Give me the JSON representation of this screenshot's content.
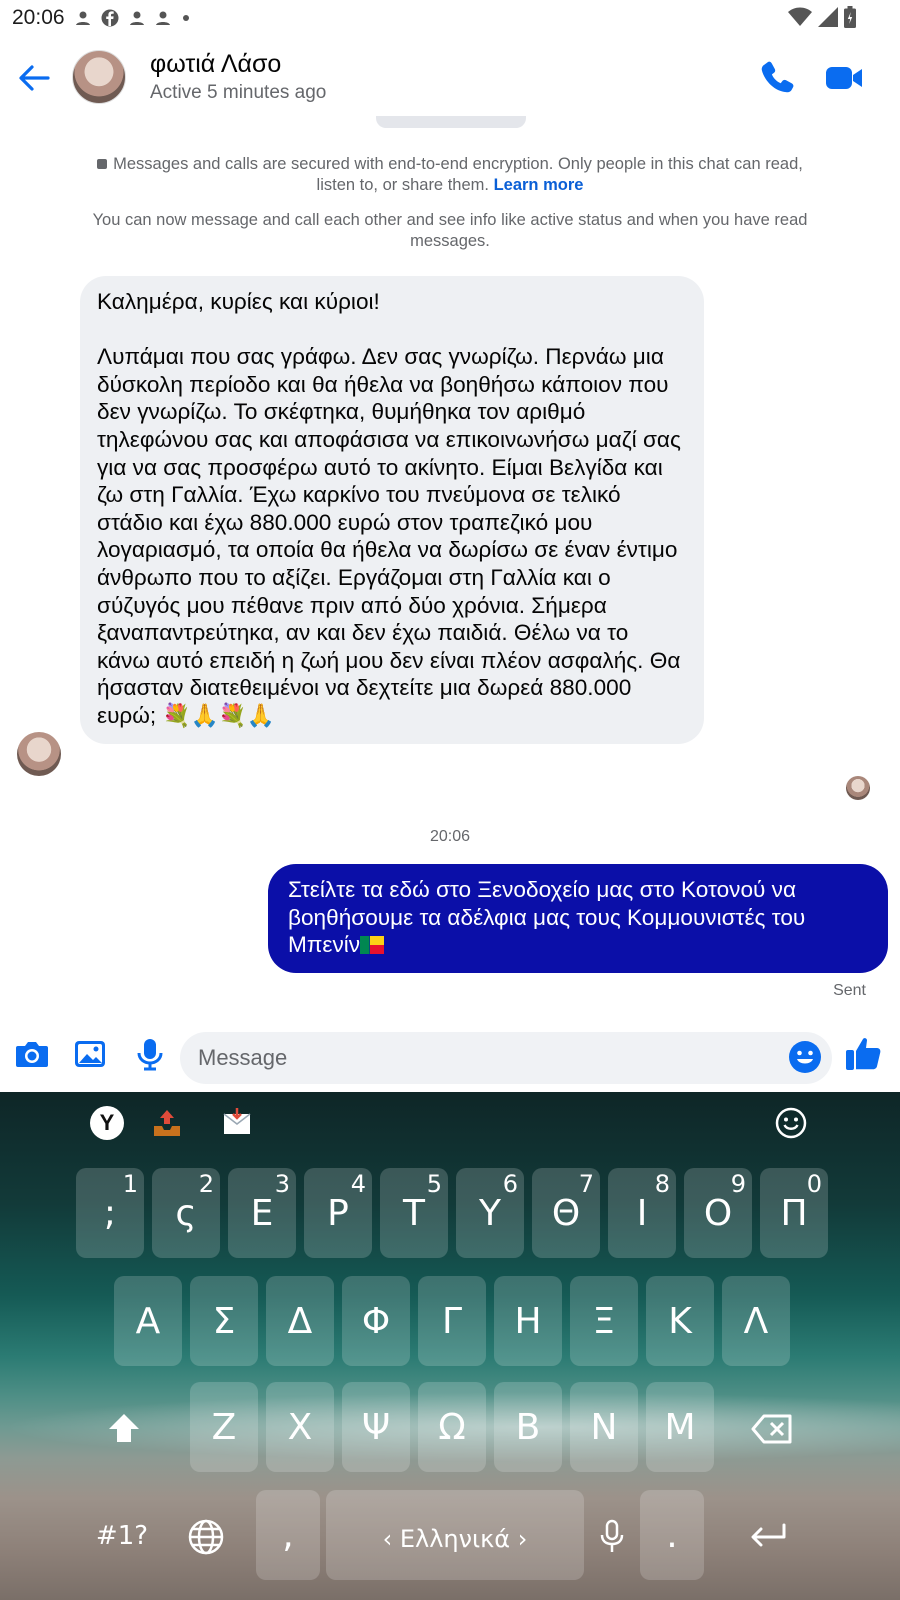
{
  "status_bar": {
    "time": "20:06",
    "icons": [
      "person-icon",
      "facebook-icon",
      "person-icon",
      "person-icon",
      "dot-icon"
    ],
    "right_icons": [
      "wifi-icon",
      "signal-icon",
      "battery-icon"
    ]
  },
  "header": {
    "name": "φωτιά Λάσο",
    "status": "Active 5 minutes ago"
  },
  "notices": {
    "encryption": "Messages and calls are secured with end-to-end encryption. Only people in this chat can read, listen to, or share them.",
    "learn_more": "Learn more",
    "active_info": "You can now message and call each other and see info like active status and when you have read messages."
  },
  "incoming_message": "Καλημέρα, κυρίες και κύριοι!\n\nΛυπάμαι που σας γράφω. Δεν σας γνωρίζω. Περνάω μια δύσκολη περίοδο και θα ήθελα να βοηθήσω κάποιον που δεν γνωρίζω. Το σκέφτηκα, θυμήθηκα τον αριθμό τηλεφώνου σας και αποφάσισα να επικοινωνήσω μαζί σας για να σας προσφέρω αυτό το ακίνητο. Είμαι Βελγίδα και ζω στη Γαλλία. Έχω καρκίνο του πνεύμονα σε τελικό στάδιο και έχω 880.000 ευρώ στον τραπεζικό μου λογαριασμό, τα οποία θα ήθελα να δωρίσω σε έναν έντιμο άνθρωπο που το αξίζει. Εργάζομαι στη Γαλλία και ο σύζυγός μου πέθανε πριν από δύο χρόνια. Σήμερα ξαναπαντρεύτηκα, αν και δεν έχω παιδιά. Θέλω να το κάνω αυτό επειδή η ζωή μου δεν είναι πλέον ασφαλής. Θα ήσασταν διατεθειμένοι να δεχτείτε μια δωρεά 880.000 ευρώ; 💐🙏💐🙏",
  "timestamp": "20:06",
  "outgoing_message": "Στείλτε τα εδώ στο Ξενοδοχείο μας στο Κοτονού να βοηθήσουμε τα αδέλφια μας τους Κομμουνιστές του Μπενίν",
  "sent_label": "Sent",
  "composer": {
    "placeholder": "Message"
  },
  "keyboard": {
    "row1": [
      {
        "k": ";",
        "n": "1"
      },
      {
        "k": "ς",
        "n": "2"
      },
      {
        "k": "Ε",
        "n": "3"
      },
      {
        "k": "Ρ",
        "n": "4"
      },
      {
        "k": "Τ",
        "n": "5"
      },
      {
        "k": "Υ",
        "n": "6"
      },
      {
        "k": "Θ",
        "n": "7"
      },
      {
        "k": "Ι",
        "n": "8"
      },
      {
        "k": "Ο",
        "n": "9"
      },
      {
        "k": "Π",
        "n": "0"
      }
    ],
    "row2": [
      "Α",
      "Σ",
      "Δ",
      "Φ",
      "Γ",
      "Η",
      "Ξ",
      "Κ",
      "Λ"
    ],
    "row3": [
      "Ζ",
      "Χ",
      "Ψ",
      "Ω",
      "Β",
      "Ν",
      "Μ"
    ],
    "symbols": "#1?",
    "comma": ",",
    "space": "‹ Ελληνικά ›",
    "period": "."
  }
}
